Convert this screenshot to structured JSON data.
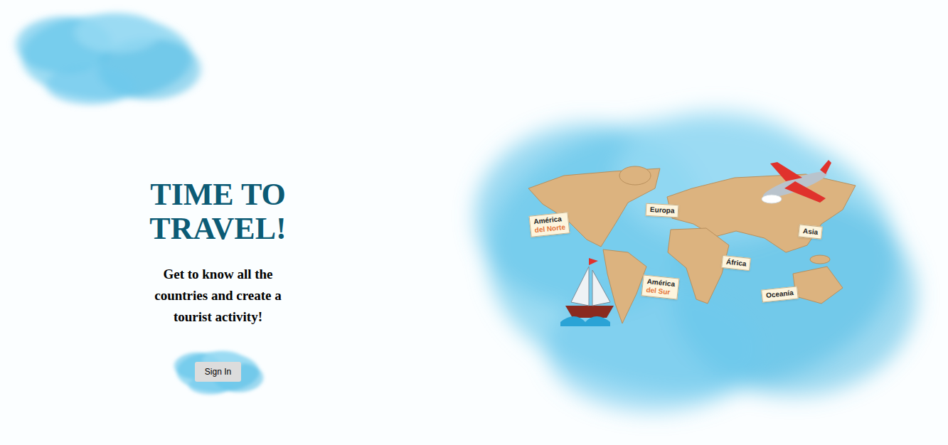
{
  "hero": {
    "title": "TIME TO TRAVEL!",
    "subtitle": "Get to know all the countries and create a tourist activity!",
    "button": "Sign In"
  },
  "map": {
    "labels": [
      {
        "lines": [
          "América",
          "del Norte"
        ]
      },
      {
        "lines": [
          "Europa"
        ]
      },
      {
        "lines": [
          "Asia"
        ]
      },
      {
        "lines": [
          "África"
        ]
      },
      {
        "lines": [
          "América",
          "del Sur"
        ]
      },
      {
        "lines": [
          "Oceanía"
        ]
      }
    ]
  }
}
